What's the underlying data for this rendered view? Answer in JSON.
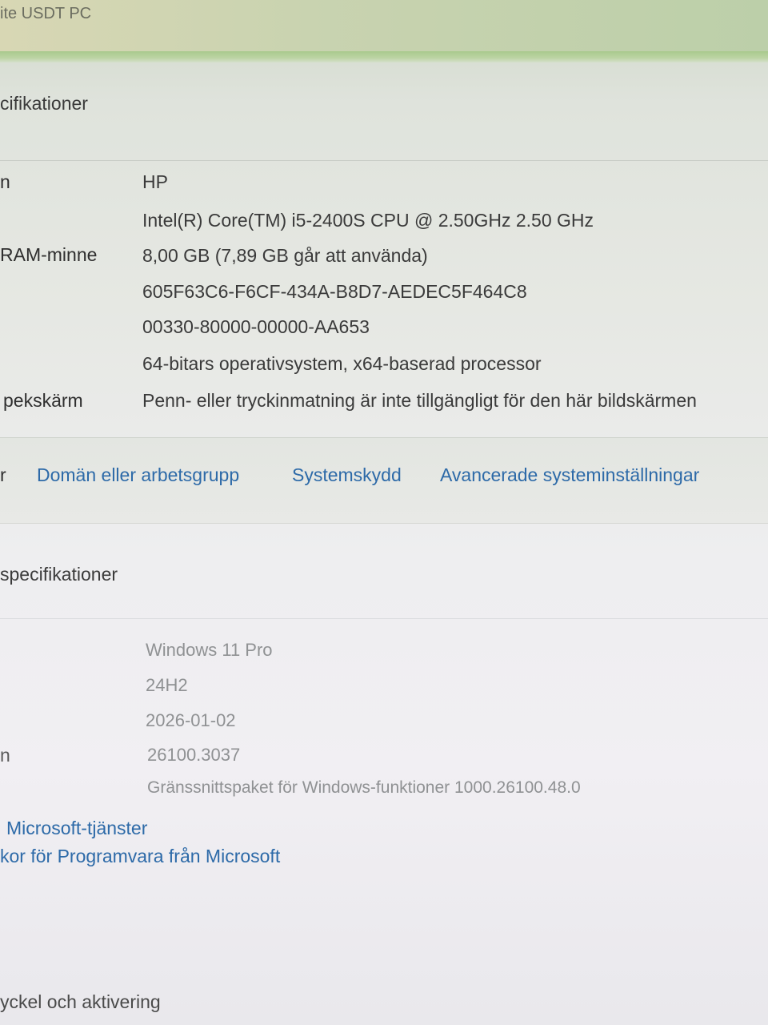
{
  "window": {
    "title": "ite USDT PC"
  },
  "device_specs": {
    "heading": "cifikationer",
    "rows": [
      {
        "label": "n",
        "value": "HP"
      },
      {
        "label": "",
        "value": "Intel(R) Core(TM) i5-2400S CPU @ 2.50GHz   2.50 GHz"
      },
      {
        "label": "RAM-minne",
        "value": "8,00 GB (7,89 GB går att använda)"
      },
      {
        "label": "",
        "value": "605F63C6-F6CF-434A-B8D7-AEDEC5F464C8"
      },
      {
        "label": "",
        "value": "00330-80000-00000-AA653"
      },
      {
        "label": "",
        "value": "64-bitars operativsystem, x64-baserad processor"
      },
      {
        "label": "pekskärm",
        "value": "Penn- eller tryckinmatning är inte tillgängligt för den här bildskärmen"
      }
    ]
  },
  "related_links": {
    "prefix": "r",
    "items": [
      "Domän eller arbetsgrupp",
      "Systemskydd",
      "Avancerade systeminställningar"
    ]
  },
  "windows_specs": {
    "heading": "specifikationer",
    "rows": [
      {
        "label": "",
        "value": "Windows 11 Pro"
      },
      {
        "label": "",
        "value": "24H2"
      },
      {
        "label": "",
        "value": "2026-01-02"
      },
      {
        "label": "n",
        "value": "26100.3037"
      },
      {
        "label": "",
        "value": "Gränssnittspaket för Windows-funktioner 1000.26100.48.0"
      }
    ],
    "links": [
      "Microsoft-tjänster",
      "kor för Programvara från Microsoft"
    ]
  },
  "footer": {
    "item": "yckel och aktivering"
  }
}
